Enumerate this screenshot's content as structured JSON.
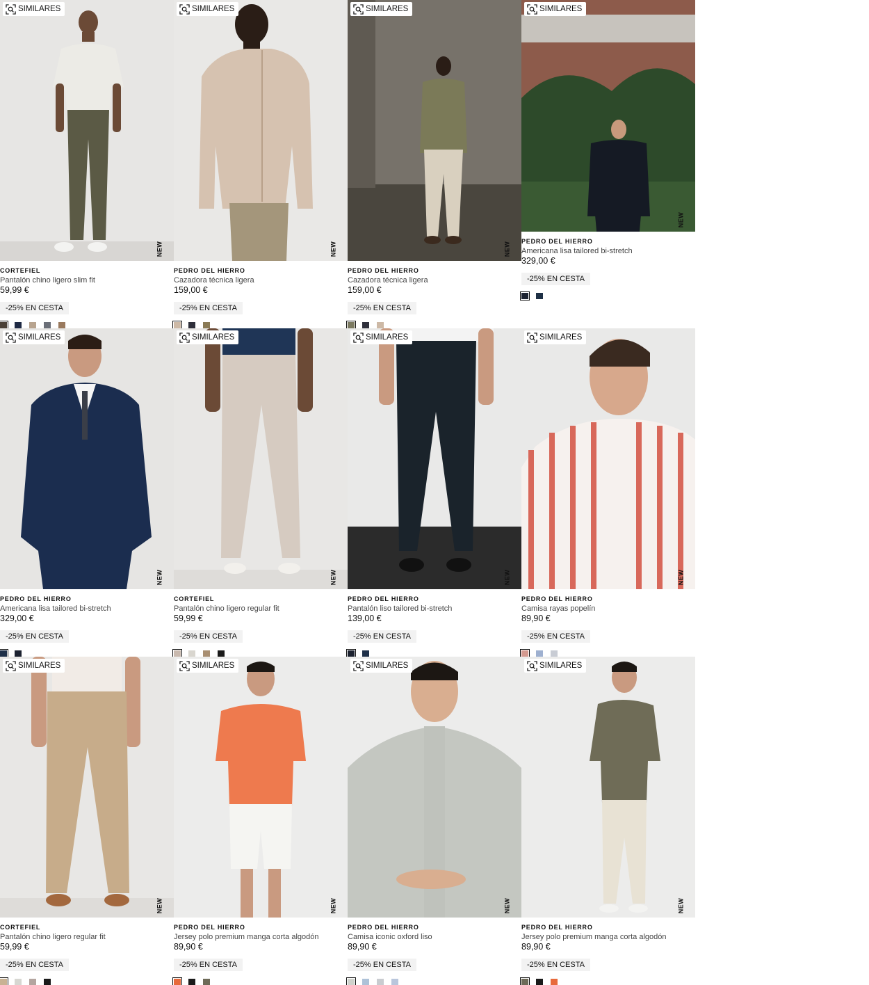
{
  "similar_label": "SIMILARES",
  "new_label": "NEW",
  "products": [
    {
      "brand": "CORTEFIEL",
      "name": "Pantalón chino ligero slim fit",
      "price": "59,99 €",
      "promo": "-25% EN CESTA",
      "swatches": [
        "#4a4036",
        "#1f2a44",
        "#b8a48f",
        "#6b6f78",
        "#9a7a5e"
      ],
      "bg": "#e7e6e4",
      "floor": "#dcdad7"
    },
    {
      "brand": "PEDRO DEL HIERRO",
      "name": "Cazadora técnica ligera",
      "price": "159,00 €",
      "promo": "-25% EN CESTA",
      "swatches": [
        "#cdb9a6",
        "#2e2f3a",
        "#8a7a55"
      ],
      "bg": "#e9e8e6",
      "floor": "#e4e2df"
    },
    {
      "brand": "PEDRO DEL HIERRO",
      "name": "Cazadora técnica ligera",
      "price": "159,00 €",
      "promo": "-25% EN CESTA",
      "swatches": [
        "#7b7960",
        "#2e2f3a",
        "#cdb9a6"
      ],
      "bg": "#6e6a62",
      "floor": "#4e4a42"
    },
    {
      "brand": "PEDRO DEL HIERRO",
      "name": "Americana lisa tailored bi-stretch",
      "price": "329,00 €",
      "promo": "-25% EN CESTA",
      "swatches": [
        "#1c2230",
        "#1e3045"
      ],
      "bg": "#8c5a4a",
      "floor": "#2f4a2c"
    },
    {
      "brand": "PEDRO DEL HIERRO",
      "name": "Americana lisa tailored bi-stretch",
      "price": "329,00 €",
      "promo": "-25% EN CESTA",
      "swatches": [
        "#1e2f48",
        "#1c2230"
      ],
      "bg": "#e6e5e3",
      "floor": "#e6e5e3"
    },
    {
      "brand": "CORTEFIEL",
      "name": "Pantalón chino ligero regular fit",
      "price": "59,99 €",
      "promo": "-25% EN CESTA",
      "swatches": [
        "#c9b9ae",
        "#d9d6cf",
        "#a98f72",
        "#1a1a1a"
      ],
      "bg": "#e8e7e5",
      "floor": "#e2e0dd"
    },
    {
      "brand": "PEDRO DEL HIERRO",
      "name": "Pantalón liso tailored bi-stretch",
      "price": "139,00 €",
      "promo": "-25% EN CESTA",
      "swatches": [
        "#1c2230",
        "#1e2f48"
      ],
      "bg": "#e9e9e8",
      "floor": "#2a2a2a"
    },
    {
      "brand": "PEDRO DEL HIERRO",
      "name": "Camisa rayas popelín",
      "price": "89,90 €",
      "promo": "-25% EN CESTA",
      "swatches": [
        "#d49a90",
        "#9eb0d0",
        "#c8ccd4"
      ],
      "bg": "#e9e9e8",
      "floor": "#e9e9e8"
    },
    {
      "brand": "CORTEFIEL",
      "name": "Pantalón chino ligero regular fit",
      "price": "59,99 €",
      "promo": "-25% EN CESTA",
      "swatches": [
        "#c9b294",
        "#d7d7d2",
        "#b4a5a0",
        "#1a1a1a"
      ],
      "bg": "#e8e7e5",
      "floor": "#e2e0dd"
    },
    {
      "brand": "PEDRO DEL HIERRO",
      "name": "Jersey polo premium manga corta algodón",
      "price": "89,90 €",
      "promo": "-25% EN CESTA",
      "swatches": [
        "#e86a3c",
        "#1a1a1a",
        "#6e6a58"
      ],
      "bg": "#ececeb",
      "floor": "#ececeb"
    },
    {
      "brand": "PEDRO DEL HIERRO",
      "name": "Camisa iconic oxford liso",
      "price": "89,90 €",
      "promo": "-25% EN CESTA",
      "swatches": [
        "#cfd2cc",
        "#aec2d8",
        "#c9ccd0",
        "#b9c6dc"
      ],
      "bg": "#ececeb",
      "floor": "#ececeb"
    },
    {
      "brand": "PEDRO DEL HIERRO",
      "name": "Jersey polo premium manga corta algodón",
      "price": "89,90 €",
      "promo": "-25% EN CESTA",
      "swatches": [
        "#6e6a58",
        "#1a1a1a",
        "#e86a3c"
      ],
      "bg": "#ececeb",
      "floor": "#ececeb"
    }
  ]
}
